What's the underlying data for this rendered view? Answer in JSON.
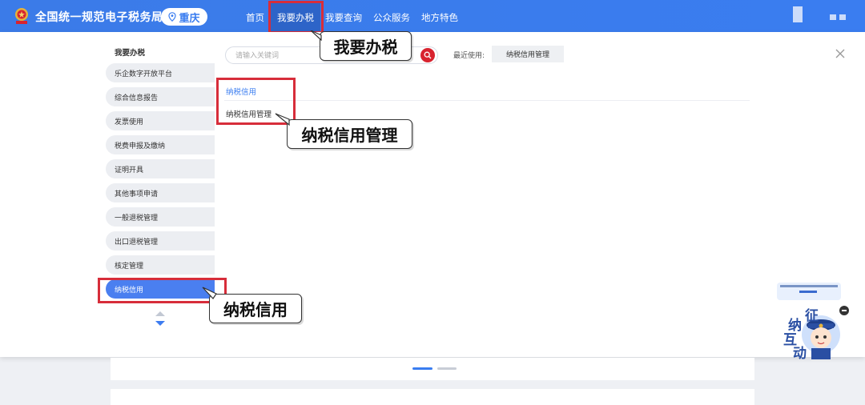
{
  "header": {
    "site_title": "全国统一规范电子税务局",
    "city": "重庆",
    "nav": [
      "首页",
      "我要办税",
      "我要查询",
      "公众服务",
      "地方特色"
    ]
  },
  "sidebar": {
    "heading": "我要办税",
    "items": [
      "乐企数字开放平台",
      "综合信息报告",
      "发票使用",
      "税费申报及缴纳",
      "证明开具",
      "其他事项申请",
      "一般退税管理",
      "出口退税管理",
      "核定管理",
      "纳税信用"
    ],
    "active_index": 9
  },
  "search": {
    "placeholder": "请输入关键词",
    "recent_label": "最近使用:",
    "recent_item": "纳税信用管理"
  },
  "content": {
    "category_title": "纳税信用",
    "category_links": [
      "纳税信用管理"
    ]
  },
  "callouts": {
    "nav": "我要办税",
    "link": "纳税信用管理",
    "sidebar": "纳税信用"
  },
  "assistant": {
    "chars": [
      "征",
      "纳",
      "互",
      "动"
    ]
  },
  "colors": {
    "primary": "#3a7df0",
    "highlight_border": "#d72d3a",
    "search_button": "#d8232f"
  }
}
